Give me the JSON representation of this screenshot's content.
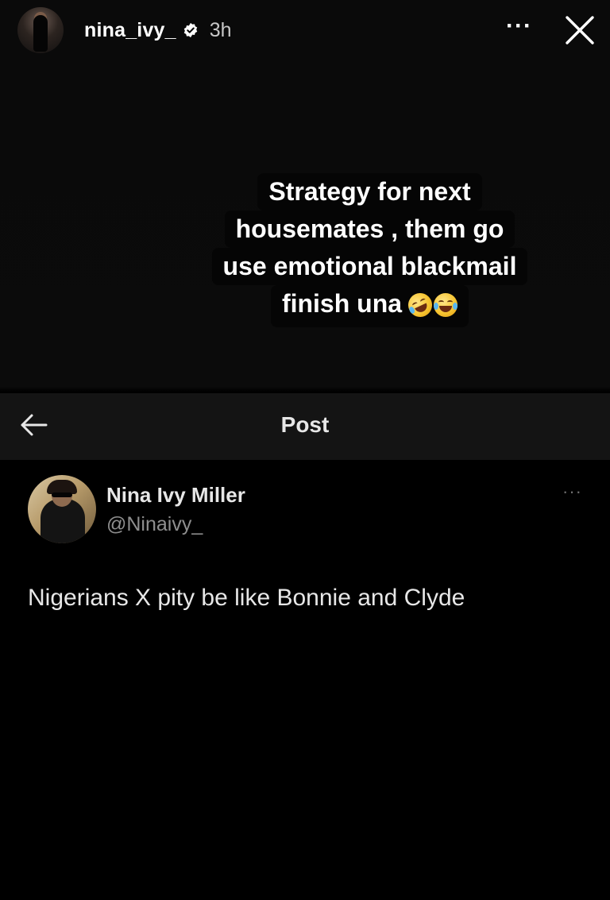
{
  "story": {
    "username": "nina_ivy_",
    "time": "3h",
    "more_label": "···",
    "icons": {
      "verified": "verified-badge-icon",
      "more": "more-options-icon",
      "close": "close-icon"
    }
  },
  "caption": {
    "lines": [
      "Strategy for next",
      "housemates , them go",
      "use emotional blackmail",
      "finish una"
    ],
    "emojis": [
      "rolling-on-floor-laughing-emoji",
      "tears-of-joy-emoji"
    ]
  },
  "post": {
    "title": "Post",
    "back_icon": "back-arrow-icon"
  },
  "tweet": {
    "display_name": "Nina Ivy Miller",
    "handle": "@Ninaivy_",
    "more_label": "···",
    "text": "Nigerians X pity be like Bonnie and Clyde"
  },
  "colors": {
    "background": "#000000",
    "post_bar": "#141414",
    "primary_text": "#e7e7e7",
    "secondary_text": "#8e8e8e",
    "verified": "#ffffff"
  }
}
